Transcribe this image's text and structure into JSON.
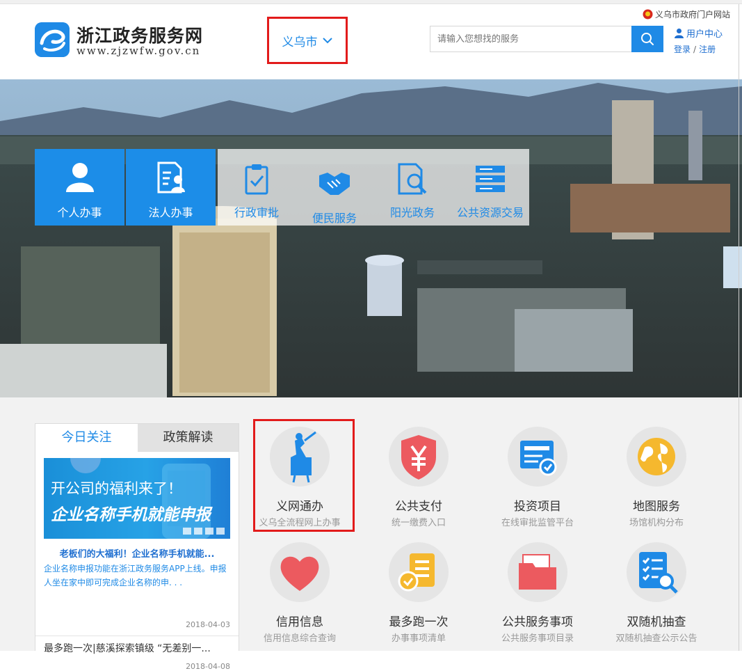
{
  "header": {
    "site_title": "浙江政务服务网",
    "site_url": "www.zjzwfw.gov.cn",
    "city": "义乌市",
    "search_placeholder": "请输入您想找的服务",
    "gov_portal_link": "义乌市政府门户网站",
    "user_center": "用户中心",
    "login": "登录",
    "separator": "/",
    "register": "注册"
  },
  "banner": {
    "tiles": [
      {
        "label": "个人办事",
        "icon": "person-icon"
      },
      {
        "label": "法人办事",
        "icon": "id-card-icon"
      },
      {
        "label": "行政审批",
        "icon": "clipboard-check-icon"
      },
      {
        "label": "便民服务",
        "icon": "handshake-icon"
      },
      {
        "label": "阳光政务",
        "icon": "document-search-icon"
      },
      {
        "label": "公共资源交易",
        "icon": "server-icon"
      }
    ]
  },
  "news": {
    "tabs": [
      "今日关注",
      "政策解读"
    ],
    "promo_line1": "开公司的福利来了！",
    "promo_line2": "企业名称手机就能申报",
    "item1_title": "老板们的大福利！企业名称手机就能...",
    "item1_desc": "企业名称申报功能在浙江政务服务APP上线。申报人坐在家中即可完成企业名称的申. . .",
    "item1_date": "2018-04-03",
    "item2_title": "最多跑一次|慈溪探索镇级 “无差别一...",
    "item2_date": "2018-04-08"
  },
  "services": [
    {
      "name": "义网通办",
      "sub": "义乌全流程网上办事",
      "icon": "statue-icon"
    },
    {
      "name": "公共支付",
      "sub": "统一缴费入口",
      "icon": "yuan-shield-icon"
    },
    {
      "name": "投资项目",
      "sub": "在线审批监管平台",
      "icon": "approval-monitor-icon"
    },
    {
      "name": "地图服务",
      "sub": "场馆机构分布",
      "icon": "globe-icon"
    },
    {
      "name": "信用信息",
      "sub": "信用信息综合查询",
      "icon": "heart-icon"
    },
    {
      "name": "最多跑一次",
      "sub": "办事事项清单",
      "icon": "checklist-icon"
    },
    {
      "name": "公共服务事项",
      "sub": "公共服务事项目录",
      "icon": "folder-icon"
    },
    {
      "name": "双随机抽查",
      "sub": "双随机抽查公示公告",
      "icon": "list-search-icon"
    }
  ],
  "colors": {
    "brand_blue": "#1f8ae6",
    "highlight_red": "#e21b1b"
  }
}
